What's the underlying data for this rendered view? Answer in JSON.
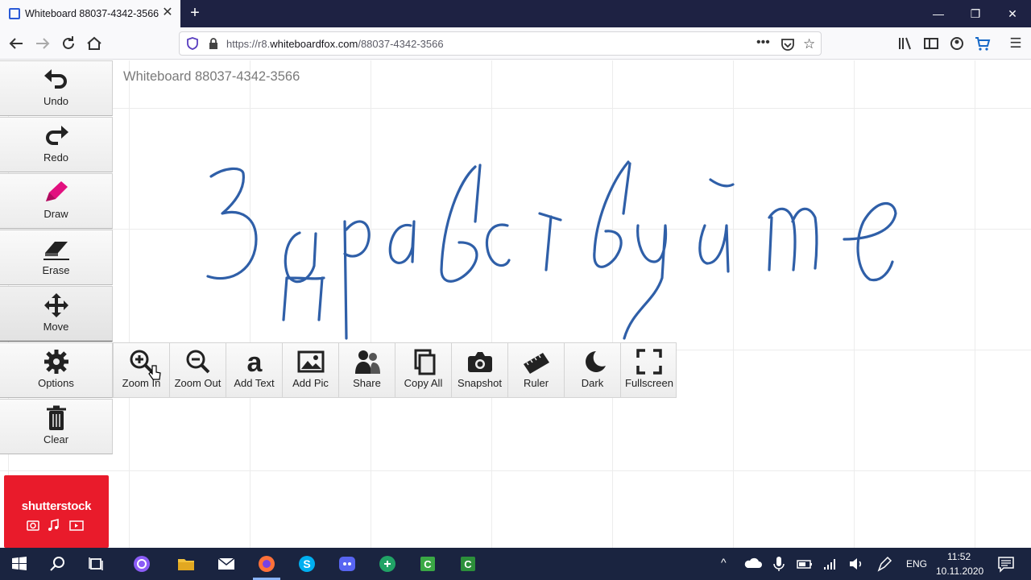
{
  "browser": {
    "tab_title": "Whiteboard 88037-4342-3566",
    "url_prefix": "https://r8.",
    "url_host": "whiteboardfox.com",
    "url_path": "/88037-4342-3566"
  },
  "page": {
    "board_title": "Whiteboard 88037-4342-3566",
    "handwriting": "Здравствуйте",
    "ink_color": "#2f5fa8"
  },
  "sidebar": [
    {
      "label": "Undo",
      "icon": "undo-icon"
    },
    {
      "label": "Redo",
      "icon": "redo-icon"
    },
    {
      "label": "Draw",
      "icon": "pencil-icon"
    },
    {
      "label": "Erase",
      "icon": "eraser-icon"
    },
    {
      "label": "Move",
      "icon": "move-icon"
    },
    {
      "label": "Options",
      "icon": "gear-icon"
    },
    {
      "label": "Clear",
      "icon": "trash-icon"
    }
  ],
  "toolbar": [
    {
      "label": "Zoom In",
      "icon": "zoom-in-icon"
    },
    {
      "label": "Zoom Out",
      "icon": "zoom-out-icon"
    },
    {
      "label": "Add Text",
      "icon": "text-icon"
    },
    {
      "label": "Add Pic",
      "icon": "picture-icon"
    },
    {
      "label": "Share",
      "icon": "people-icon"
    },
    {
      "label": "Copy All",
      "icon": "copy-icon"
    },
    {
      "label": "Snapshot",
      "icon": "camera-icon"
    },
    {
      "label": "Ruler",
      "icon": "ruler-icon"
    },
    {
      "label": "Dark",
      "icon": "moon-icon"
    },
    {
      "label": "Fullscreen",
      "icon": "fullscreen-icon"
    }
  ],
  "ad": {
    "text": "shutterstock",
    "color": "#e91b2b"
  },
  "taskbar": {
    "language": "ENG",
    "time": "11:52",
    "date": "10.11.2020"
  }
}
